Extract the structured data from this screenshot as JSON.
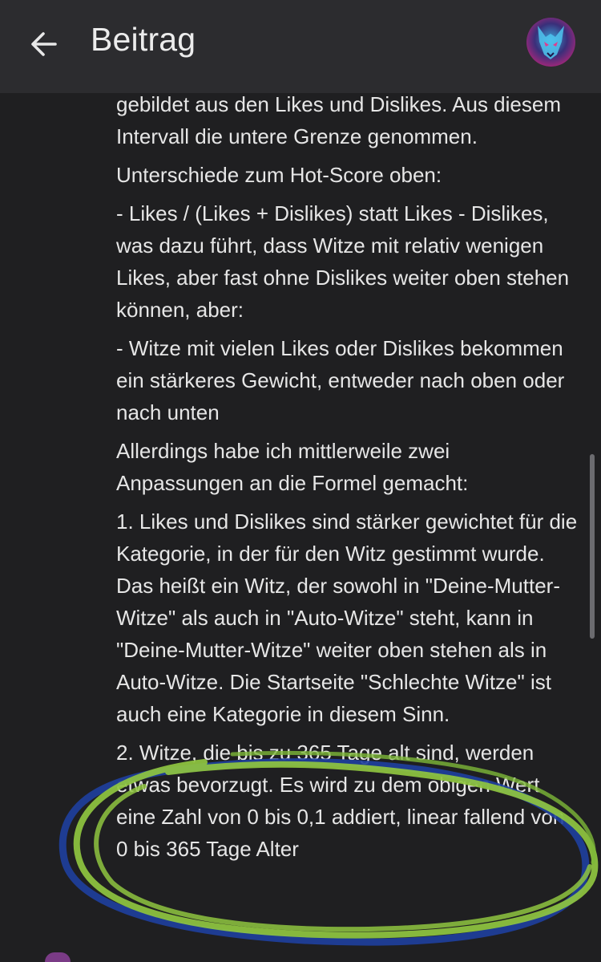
{
  "header": {
    "title": "Beitrag",
    "back_icon": "arrow-left-icon",
    "avatar_icon": "wolf-avatar"
  },
  "post": {
    "paragraphs": [
      "gebildet aus den Likes und Dislikes. Aus diesem Intervall die untere Grenze genommen.",
      "Unterschiede zum Hot-Score oben:",
      "- Likes / (Likes + Dislikes) statt Likes - Dislikes, was dazu führt, dass Witze mit relativ wenigen Likes, aber fast ohne Dislikes weiter oben stehen können, aber:",
      "- Witze mit vielen Likes oder Dislikes bekommen ein stärkeres Gewicht, entweder nach oben oder nach unten",
      "Allerdings habe ich mittlerweile zwei Anpassungen an die Formel gemacht:",
      "1. Likes und Dislikes sind stärker gewichtet für die Kategorie, in der für den Witz gestimmt wurde. Das heißt ein Witz, der sowohl in \"Deine-Mutter-Witze\" als auch in \"Auto-Witze\" steht, kann in \"Deine-Mutter-Witze\" weiter oben stehen als in Auto-Witze. Die Startseite \"Schlechte Witze\" ist auch eine Kategorie in diesem Sinn.",
      "2. Witze, die bis zu 365 Tage alt sind, werden etwas bevorzugt. Es wird zu dem obigen Wert eine Zahl von 0 bis 0,1 addiert, linear fallend von 0 bis 365 Tage Alter"
    ]
  },
  "colors": {
    "background": "#1f1f21",
    "header": "#2c2c2f",
    "text": "#e6e6e6",
    "highlight_green": "#8fc640",
    "highlight_blue": "#1e3f9e"
  }
}
